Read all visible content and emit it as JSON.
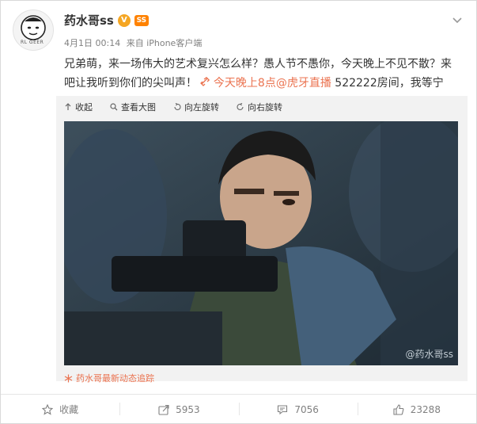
{
  "post": {
    "username": "药水哥ss",
    "verify_badge": "V",
    "member_badge": "SS",
    "date": "4月1日 00:14",
    "source": "来自 iPhone客户端",
    "avatar_tag": "RL GEER",
    "text_main": "兄弟萌，来一场伟大的艺术复兴怎么样？愚人节不愚你，今天晚上不见不散？来吧让我听到你们的尖叫声！",
    "link_text": "今天晚上8点@虎牙直播",
    "text_tail": " 522222房间，我等宁"
  },
  "toolbar": {
    "collapse": "收起",
    "view_large": "查看大图",
    "rotate_left": "向左旋转",
    "rotate_right": "向右旋转"
  },
  "watermark": "@药水哥ss",
  "follow_link": "药水哥最新动态追踪",
  "actions": {
    "favorite": "收藏",
    "repost": "5953",
    "comment": "7056",
    "like": "23288"
  },
  "colors": {
    "accent": "#eb7350",
    "verify": "#f5a623",
    "text": "#333333",
    "meta": "#808080"
  }
}
